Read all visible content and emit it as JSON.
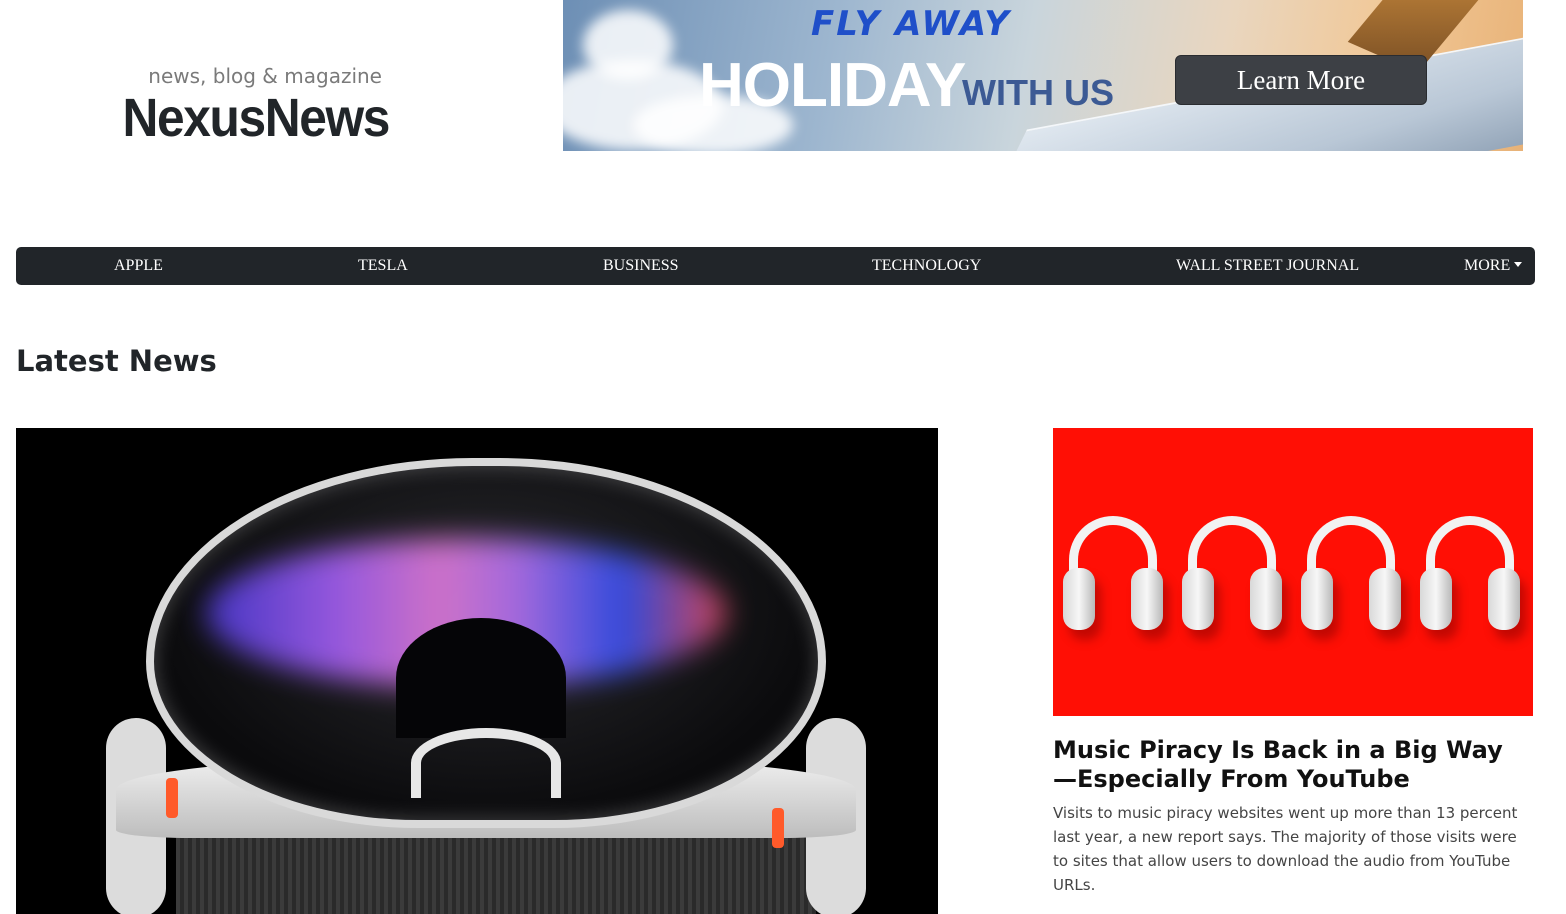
{
  "header": {
    "tagline": "news, blog & magazine",
    "brand": "NexusNews"
  },
  "banner": {
    "line1": "FLY AWAY",
    "line2": "HOLIDAY",
    "line3": "WITH US",
    "cta": "Learn More"
  },
  "nav": {
    "items": [
      "APPLE",
      "TESLA",
      "BUSINESS",
      "TECHNOLOGY",
      "WALL STREET JOURNAL"
    ],
    "more": "MORE",
    "more_icon": "caret-down-icon"
  },
  "main": {
    "section_title": "Latest News"
  },
  "side_article": {
    "title": "Music Piracy Is Back in a Big Way—Especially From YouTube",
    "summary": "Visits to music piracy websites went up more than 13 percent last year, a new report says. The majority of those visits were to sites that allow users to download the audio from YouTube URLs."
  },
  "colors": {
    "navbar": "#212529",
    "side_image_bg": "#ff0f05",
    "cta_bg": "#3d4045"
  }
}
